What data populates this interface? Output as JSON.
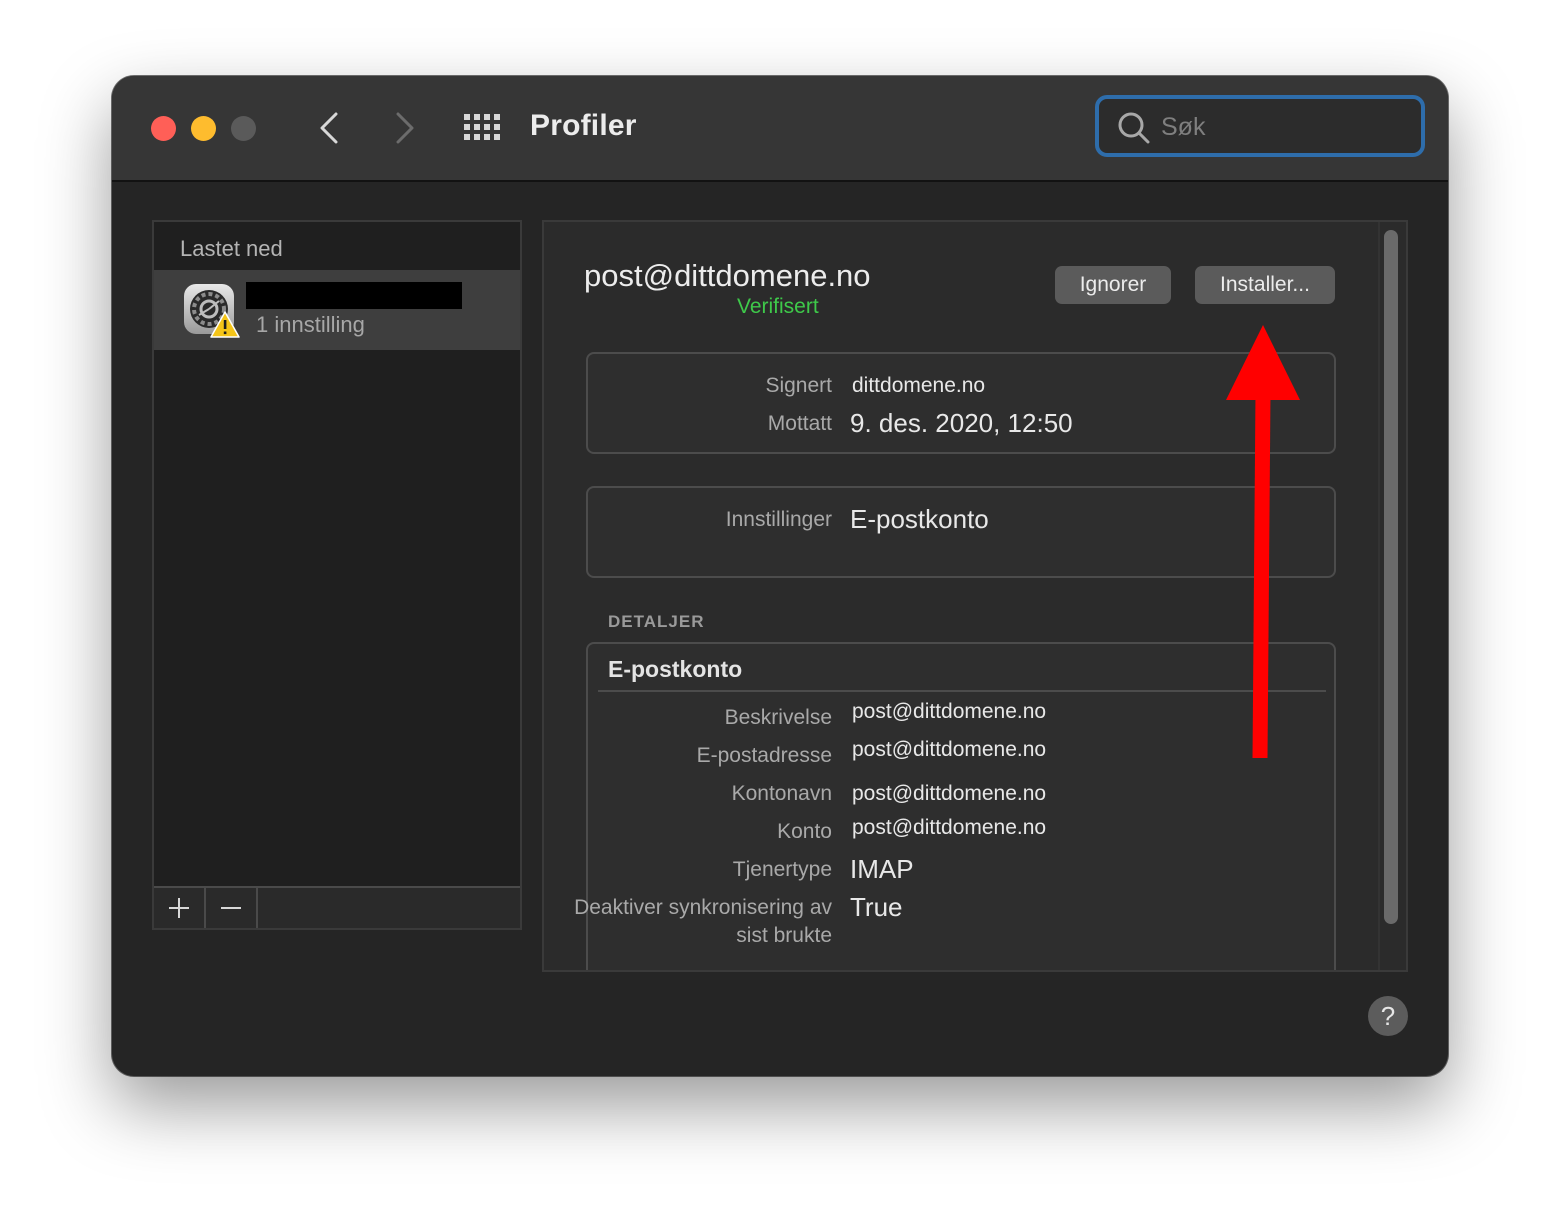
{
  "window": {
    "title": "Profiler"
  },
  "search": {
    "placeholder": "Søk",
    "value": ""
  },
  "sidebar": {
    "section_header": "Lastet ned",
    "profiles": [
      {
        "subtitle": "1 innstilling",
        "name_redacted": true
      }
    ]
  },
  "profile": {
    "name": "post@dittdomene.no",
    "status": "Verifisert",
    "ignore_label": "Ignorer",
    "install_label": "Installer...",
    "signed_label": "Signert",
    "signed_value": "dittdomene.no",
    "received_label": "Mottatt",
    "received_value": "9. des. 2020, 12:50",
    "settings_label": "Innstillinger",
    "settings_value": "E-postkonto"
  },
  "details": {
    "heading": "DETALJER",
    "section_title": "E-postkonto",
    "rows": [
      {
        "label": "Beskrivelse",
        "value": "post@dittdomene.no"
      },
      {
        "label": "E-postadresse",
        "value": "post@dittdomene.no"
      },
      {
        "label": "Kontonavn",
        "value": "post@dittdomene.no"
      },
      {
        "label": "Konto",
        "value": "post@dittdomene.no"
      },
      {
        "label": "Tjenertype",
        "value": "IMAP"
      },
      {
        "label": "Deaktiver synkronisering av sist brukte",
        "value": "True"
      }
    ]
  },
  "help": {
    "label": "?"
  },
  "colors": {
    "accent_focus": "#2e6dab",
    "verified_green": "#3ec94a",
    "annotation_arrow": "#ff0000"
  }
}
